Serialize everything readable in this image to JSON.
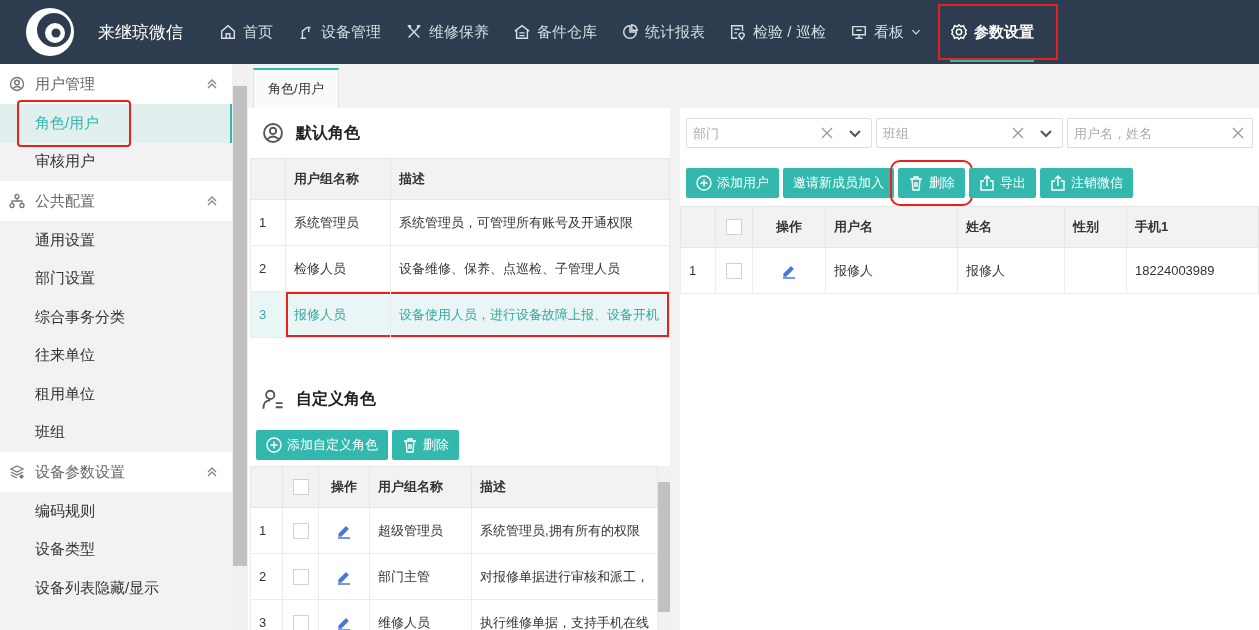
{
  "app": {
    "title": "来继琼微信"
  },
  "nav": [
    {
      "label": "首页",
      "selected": false,
      "annotated": false,
      "dropdown": false
    },
    {
      "label": "设备管理",
      "selected": false,
      "annotated": false,
      "dropdown": false
    },
    {
      "label": "维修保养",
      "selected": false,
      "annotated": false,
      "dropdown": false
    },
    {
      "label": "备件仓库",
      "selected": false,
      "annotated": false,
      "dropdown": false
    },
    {
      "label": "统计报表",
      "selected": false,
      "annotated": false,
      "dropdown": false
    },
    {
      "label": "检验 / 巡检",
      "selected": false,
      "annotated": false,
      "dropdown": false
    },
    {
      "label": "看板",
      "selected": false,
      "annotated": false,
      "dropdown": true
    },
    {
      "label": "参数设置",
      "selected": true,
      "annotated": true,
      "dropdown": false
    }
  ],
  "sidebar": {
    "groups": [
      {
        "label": "用户管理",
        "expanded": true,
        "children": [
          {
            "label": "角色/用户",
            "selected": true,
            "annotated": true
          },
          {
            "label": "审核用户",
            "selected": false,
            "annotated": false
          }
        ]
      },
      {
        "label": "公共配置",
        "expanded": true,
        "children": [
          {
            "label": "通用设置",
            "selected": false,
            "annotated": false
          },
          {
            "label": "部门设置",
            "selected": false,
            "annotated": false
          },
          {
            "label": "综合事务分类",
            "selected": false,
            "annotated": false
          },
          {
            "label": "往来单位",
            "selected": false,
            "annotated": false
          },
          {
            "label": "租用单位",
            "selected": false,
            "annotated": false
          },
          {
            "label": "班组",
            "selected": false,
            "annotated": false
          }
        ]
      },
      {
        "label": "设备参数设置",
        "expanded": true,
        "children": [
          {
            "label": "编码规则",
            "selected": false,
            "annotated": false
          },
          {
            "label": "设备类型",
            "selected": false,
            "annotated": false
          },
          {
            "label": "设备列表隐藏/显示",
            "selected": false,
            "annotated": false
          }
        ]
      }
    ]
  },
  "tabs": [
    {
      "label": "角色/用户",
      "selected": true
    }
  ],
  "default_roles": {
    "title": "默认角色",
    "columns": [
      "用户组名称",
      "描述"
    ],
    "rows": [
      {
        "index": "1",
        "name": "系统管理员",
        "description": "系统管理员，可管理所有账号及开通权限",
        "selected": false,
        "annotated": false
      },
      {
        "index": "2",
        "name": "检修人员",
        "description": "设备维修、保养、点巡检、子管理人员",
        "selected": false,
        "annotated": false
      },
      {
        "index": "3",
        "name": "报修人员",
        "description": "设备使用人员，进行设备故障上报、设备开机",
        "selected": true,
        "annotated": true
      }
    ]
  },
  "custom_roles": {
    "title": "自定义角色",
    "buttons": [
      {
        "label": "添加自定义角色",
        "kind": "add",
        "annotated": false
      },
      {
        "label": "删除",
        "kind": "delete",
        "annotated": false
      }
    ],
    "header_checked": false,
    "columns": [
      "操作",
      "用户组名称",
      "描述"
    ],
    "rows": [
      {
        "index": "1",
        "checked": false,
        "name": "超级管理员",
        "description": "系统管理员,拥有所有的权限"
      },
      {
        "index": "2",
        "checked": false,
        "name": "部门主管",
        "description": "对报修单据进行审核和派工，"
      },
      {
        "index": "3",
        "checked": false,
        "name": "维修人员",
        "description": "执行维修单据，支持手机在线"
      }
    ]
  },
  "users": {
    "filters": [
      {
        "placeholder": "部门",
        "kind": "select"
      },
      {
        "placeholder": "班组",
        "kind": "select"
      },
      {
        "placeholder": "用户名，姓名",
        "kind": "text"
      }
    ],
    "buttons": [
      {
        "label": "添加用户",
        "kind": "add",
        "annotated": false
      },
      {
        "label": "邀请新成员加入",
        "kind": "plain",
        "annotated": false
      },
      {
        "label": "删除",
        "kind": "delete",
        "annotated": true
      },
      {
        "label": "导出",
        "kind": "export",
        "annotated": false
      },
      {
        "label": "注销微信",
        "kind": "export",
        "annotated": false
      }
    ],
    "header_checked": false,
    "columns": [
      "操作",
      "用户名",
      "姓名",
      "性别",
      "手机1"
    ],
    "rows": [
      {
        "index": "1",
        "checked": false,
        "cells": [
          "",
          "报修人",
          "报修人",
          "",
          "18224003989"
        ]
      }
    ]
  }
}
